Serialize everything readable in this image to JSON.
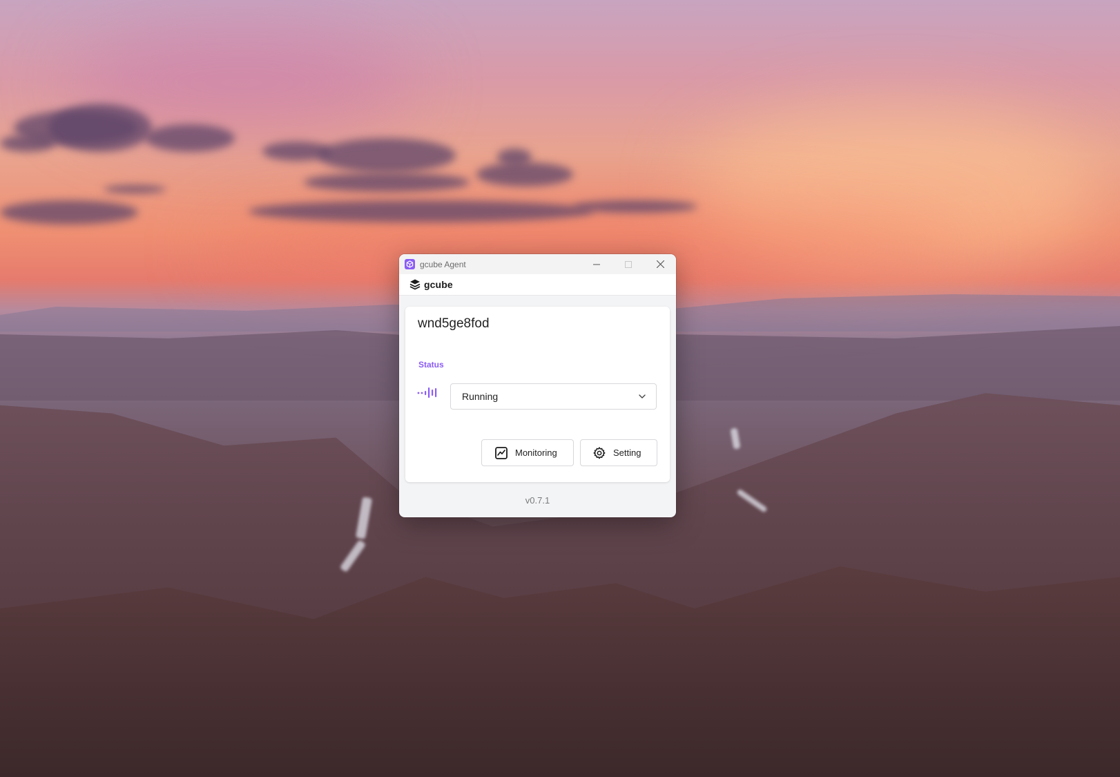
{
  "window": {
    "title": "gcube Agent",
    "app_icon": "gcube-cube-icon",
    "controls": [
      "minimize-icon",
      "maximize-icon",
      "close-icon"
    ]
  },
  "header": {
    "brand": "gcube",
    "logo_icon": "stacked-layers-icon"
  },
  "agent": {
    "name": "wnd5ge8fod"
  },
  "status": {
    "label": "Status",
    "icon": "signal-bars-icon",
    "selected": "Running"
  },
  "actions": {
    "monitoring_label": "Monitoring",
    "monitoring_icon": "chart-line-icon",
    "setting_label": "Setting",
    "setting_icon": "gear-icon"
  },
  "footer": {
    "version": "v0.7.1"
  },
  "colors": {
    "accent": "#8b5cf6",
    "window_bg": "#f3f4f6",
    "card_bg": "#ffffff"
  }
}
